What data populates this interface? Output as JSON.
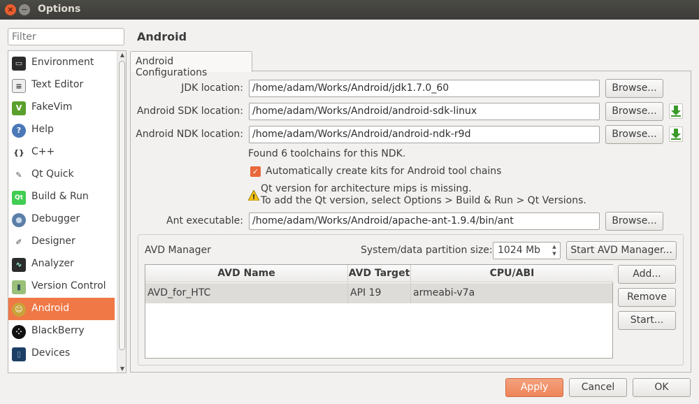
{
  "window": {
    "title": "Options",
    "close_glyph": "×",
    "min_glyph": "−"
  },
  "sidebar": {
    "filter_placeholder": "Filter",
    "items": [
      {
        "label": "Environment",
        "icon": "monitor-icon",
        "glyph": "▭"
      },
      {
        "label": "Text Editor",
        "icon": "text-document-icon",
        "glyph": "≡"
      },
      {
        "label": "FakeVim",
        "icon": "fakevim-icon",
        "glyph": "V"
      },
      {
        "label": "Help",
        "icon": "help-icon",
        "glyph": "?"
      },
      {
        "label": "C++",
        "icon": "braces-icon",
        "glyph": "{}"
      },
      {
        "label": "Qt Quick",
        "icon": "qt-quick-icon",
        "glyph": "✎"
      },
      {
        "label": "Build & Run",
        "icon": "build-run-icon",
        "glyph": "Qt"
      },
      {
        "label": "Debugger",
        "icon": "debugger-icon",
        "glyph": "●"
      },
      {
        "label": "Designer",
        "icon": "designer-icon",
        "glyph": "✐"
      },
      {
        "label": "Analyzer",
        "icon": "analyzer-icon",
        "glyph": "∿"
      },
      {
        "label": "Version Control",
        "icon": "version-control-icon",
        "glyph": "▮"
      },
      {
        "label": "Android",
        "icon": "android-icon",
        "glyph": "☺",
        "selected": true
      },
      {
        "label": "BlackBerry",
        "icon": "blackberry-icon",
        "glyph": "⁘"
      },
      {
        "label": "Devices",
        "icon": "device-icon",
        "glyph": "▯"
      }
    ]
  },
  "page": {
    "title": "Android",
    "tab": "Android Configurations"
  },
  "jdk": {
    "label": "JDK location:",
    "value": "/home/adam/Works/Android/jdk1.7.0_60",
    "browse": "Browse..."
  },
  "sdk": {
    "label": "Android SDK location:",
    "value": "/home/adam/Works/Android/android-sdk-linux",
    "browse": "Browse..."
  },
  "ndk": {
    "label": "Android NDK location:",
    "value": "/home/adam/Works/Android/android-ndk-r9d",
    "browse": "Browse..."
  },
  "toolchains_info": "Found 6 toolchains for this NDK.",
  "auto_kits": {
    "label": "Automatically create kits for Android tool chains",
    "checked": true,
    "check_glyph": "✓"
  },
  "warning": {
    "icon": "warning-icon",
    "glyph": "!",
    "line1": "Qt version for architecture mips is missing.",
    "line2": "To add the Qt version, select Options > Build & Run > Qt Versions."
  },
  "ant": {
    "label": "Ant executable:",
    "value": "/home/adam/Works/Android/apache-ant-1.9.4/bin/ant",
    "browse": "Browse..."
  },
  "avd": {
    "title": "AVD Manager",
    "partition_label": "System/data partition size:",
    "partition_value": "1024 Mb",
    "spin_up": "▲",
    "spin_down": "▼",
    "start_manager": "Start AVD Manager...",
    "columns": [
      "AVD Name",
      "AVD Target",
      "CPU/ABI"
    ],
    "rows": [
      {
        "name": "AVD_for_HTC",
        "target": "API 19",
        "abi": "armeabi-v7a"
      }
    ],
    "add": "Add...",
    "remove": "Remove",
    "start": "Start..."
  },
  "dialog_buttons": {
    "apply": "Apply",
    "cancel": "Cancel",
    "ok": "OK"
  },
  "colors": {
    "accent": "#f07746",
    "download": "#3a9a2a",
    "warning": "#f5c211"
  }
}
